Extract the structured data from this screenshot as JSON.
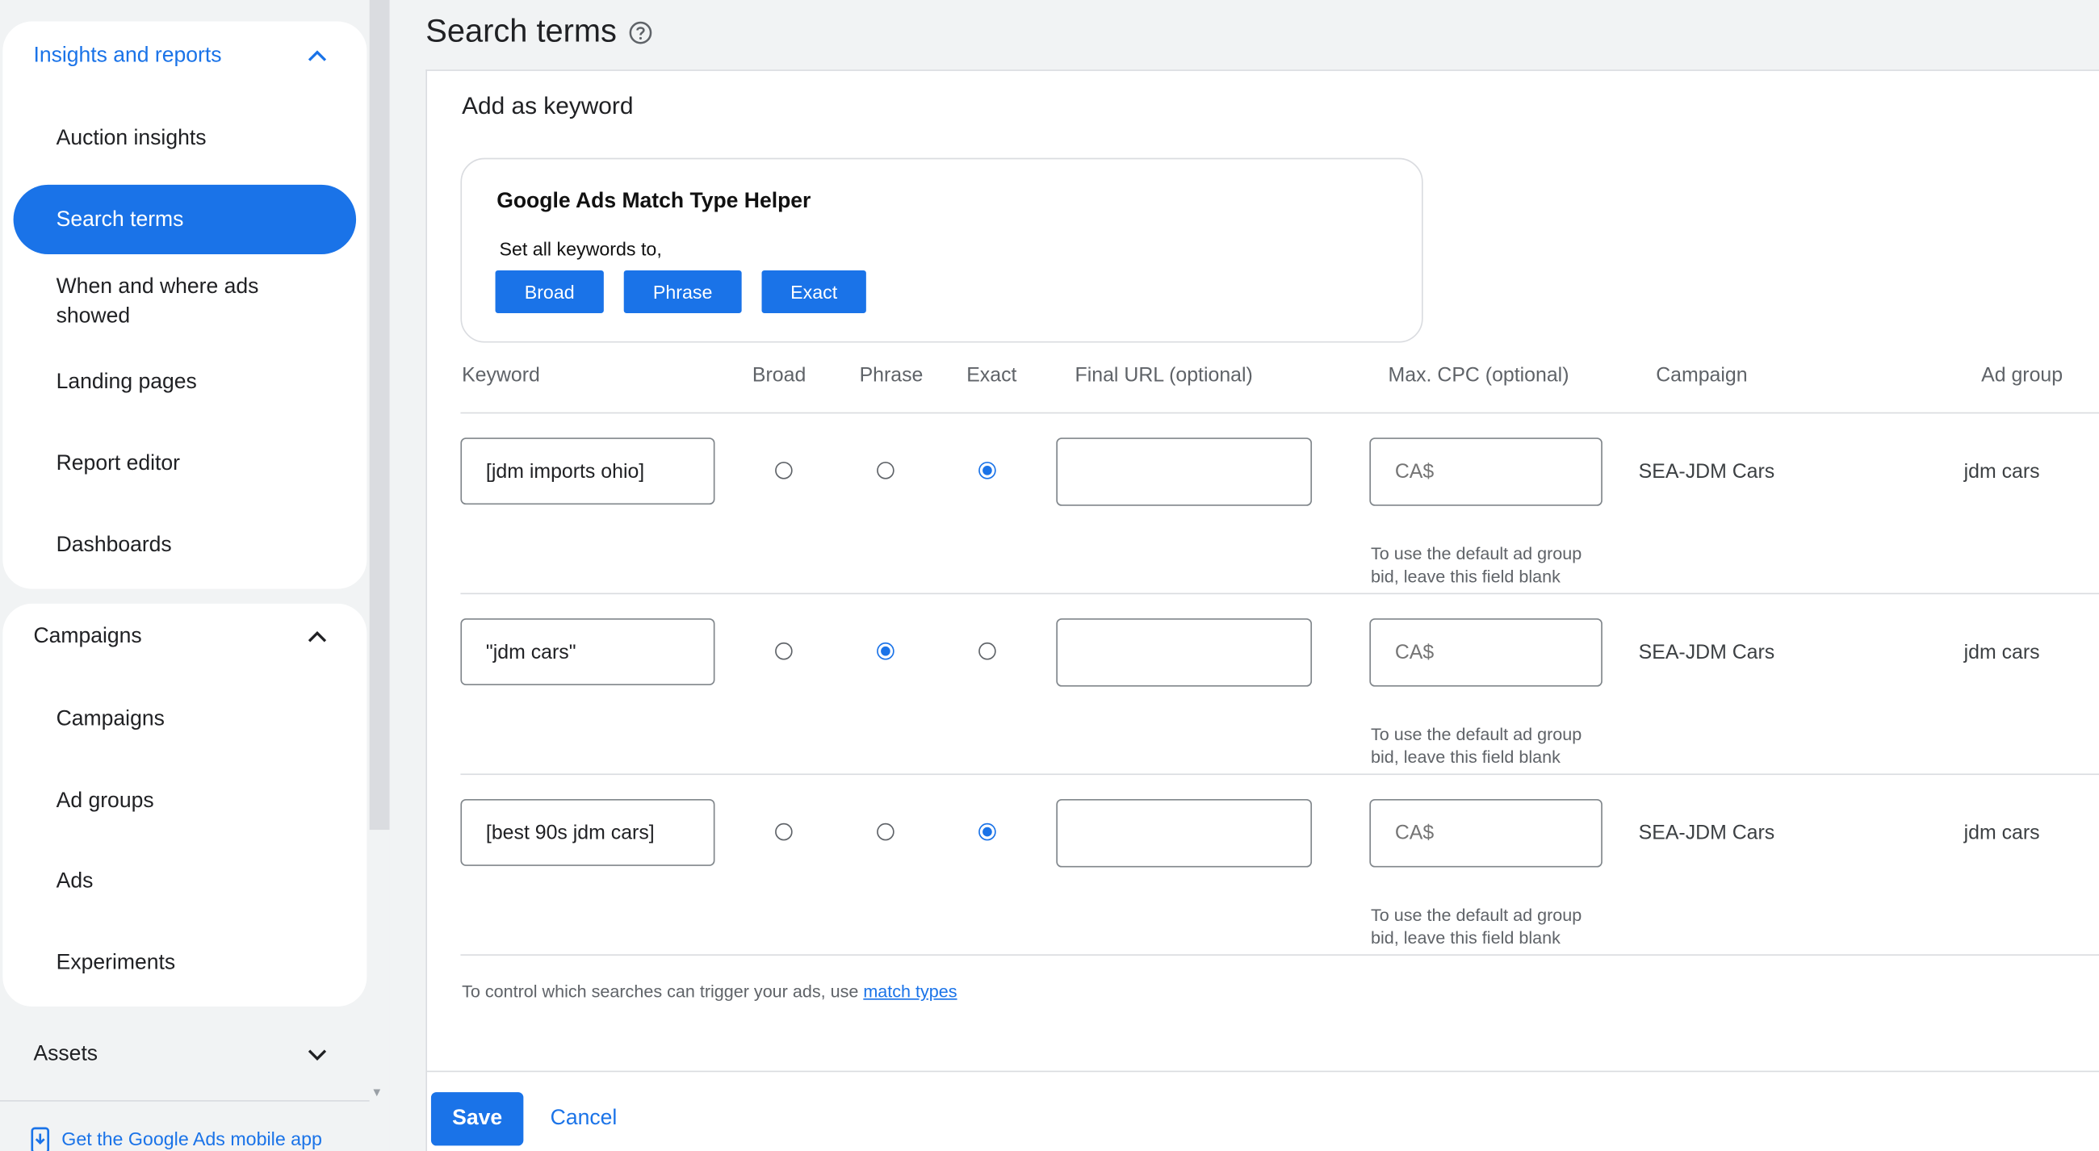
{
  "sidebar": {
    "insights": {
      "header": "Insights and reports",
      "items": [
        "Auction insights",
        "Search terms",
        "When and where ads showed",
        "Landing pages",
        "Report editor",
        "Dashboards"
      ]
    },
    "campaigns": {
      "header": "Campaigns",
      "items": [
        "Campaigns",
        "Ad groups",
        "Ads",
        "Experiments"
      ]
    },
    "assets": {
      "header": "Assets"
    },
    "mobile_app_link": "Get the Google Ads mobile app"
  },
  "page": {
    "title": "Search terms",
    "panel_title": "Add as keyword"
  },
  "helper": {
    "title": "Google Ads Match Type Helper",
    "subtitle": "Set all keywords to,",
    "buttons": [
      "Broad",
      "Phrase",
      "Exact"
    ]
  },
  "table": {
    "headers": {
      "keyword": "Keyword",
      "broad": "Broad",
      "phrase": "Phrase",
      "exact": "Exact",
      "final_url": "Final URL (optional)",
      "max_cpc": "Max. CPC (optional)",
      "campaign": "Campaign",
      "ad_group": "Ad group"
    },
    "rows": [
      {
        "keyword": "[jdm imports ohio]",
        "match": "exact",
        "final_url": "",
        "cpc_placeholder": "CA$",
        "cpc_hint": "To use the default ad group bid, leave this field blank",
        "campaign": "SEA-JDM Cars",
        "ad_group": "jdm cars"
      },
      {
        "keyword": "\"jdm cars\"",
        "match": "phrase",
        "final_url": "",
        "cpc_placeholder": "CA$",
        "cpc_hint": "To use the default ad group bid, leave this field blank",
        "campaign": "SEA-JDM Cars",
        "ad_group": "jdm cars"
      },
      {
        "keyword": "[best 90s jdm cars]",
        "match": "exact",
        "final_url": "",
        "cpc_placeholder": "CA$",
        "cpc_hint": "To use the default ad group bid, leave this field blank",
        "campaign": "SEA-JDM Cars",
        "ad_group": "jdm cars"
      }
    ]
  },
  "footer": {
    "note_prefix": "To control which searches can trigger your ads, use ",
    "note_link": "match types",
    "save": "Save",
    "cancel": "Cancel"
  },
  "colors": {
    "accent": "#1a73e8",
    "text": "#202124",
    "muted": "#5f6368",
    "border": "#dadce0"
  }
}
